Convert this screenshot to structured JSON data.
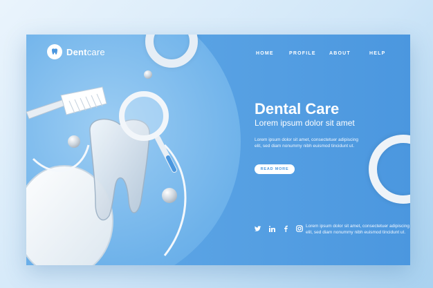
{
  "brand": {
    "name_bold": "Dent",
    "name_light": "care"
  },
  "nav": {
    "items": [
      "HOME",
      "PROFILE",
      "ABOUT",
      "HELP"
    ]
  },
  "hero": {
    "title": "Dental Care",
    "subtitle": "Lorem ipsum dolor sit amet",
    "body": "Lorem ipsum dolor sit amet, consectetuer adipiscing elit, sed diam nonummy nibh euismod tincidunt ut.",
    "cta": "READ MORE"
  },
  "footer": {
    "text": "Lorem ipsum dolor sit amet, consectetuer adipiscing elit, sed diam nonummy nibh euismod tincidunt ut.",
    "social": [
      "twitter-icon",
      "linkedin-icon",
      "facebook-icon",
      "instagram-icon"
    ]
  },
  "colors": {
    "primary": "#4b97df",
    "light": "#8fc3ee",
    "white": "#ffffff"
  }
}
